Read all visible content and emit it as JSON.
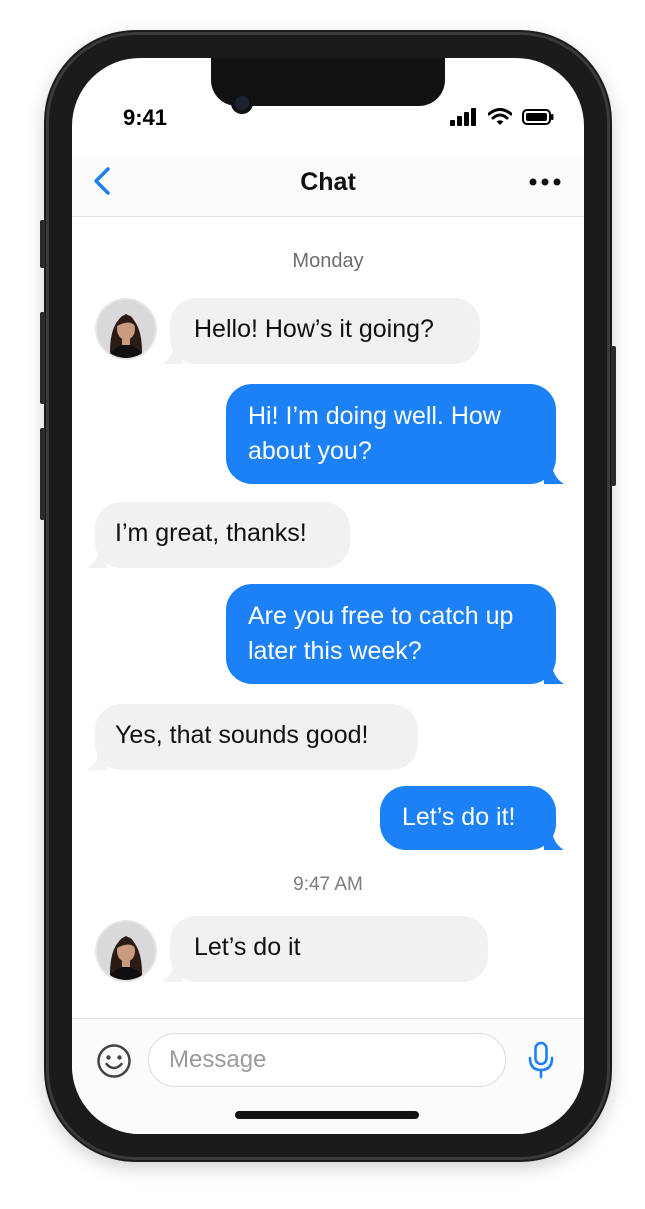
{
  "status_bar": {
    "time": "9:41"
  },
  "header": {
    "title": "Chat"
  },
  "conversation": {
    "day_label": "Monday",
    "time_label": "9:47 AM",
    "messages": [
      {
        "direction": "incoming",
        "text": "Hello! How’s it going?"
      },
      {
        "direction": "outgoing",
        "text": "Hi! I’m doing well. How about you?"
      },
      {
        "direction": "incoming",
        "text": "I’m great, thanks!"
      },
      {
        "direction": "outgoing",
        "text": "Are you free to catch up later this week?"
      },
      {
        "direction": "incoming",
        "text": "Yes, that sounds good!"
      },
      {
        "direction": "outgoing",
        "text": "Let’s do it!"
      },
      {
        "direction": "incoming",
        "text": "Let’s do it"
      }
    ]
  },
  "composer": {
    "placeholder": "Message"
  },
  "icons": {
    "back": "chevron-left-icon",
    "more": "ellipsis-icon",
    "emoji": "smiley-icon",
    "mic": "microphone-icon",
    "signal": "cellular-signal-icon",
    "wifi": "wifi-icon",
    "battery": "battery-icon"
  },
  "colors": {
    "accent": "#1c80f6",
    "incoming_bubble": "#f1f1f3",
    "outgoing_bubble": "#1c80f6"
  }
}
